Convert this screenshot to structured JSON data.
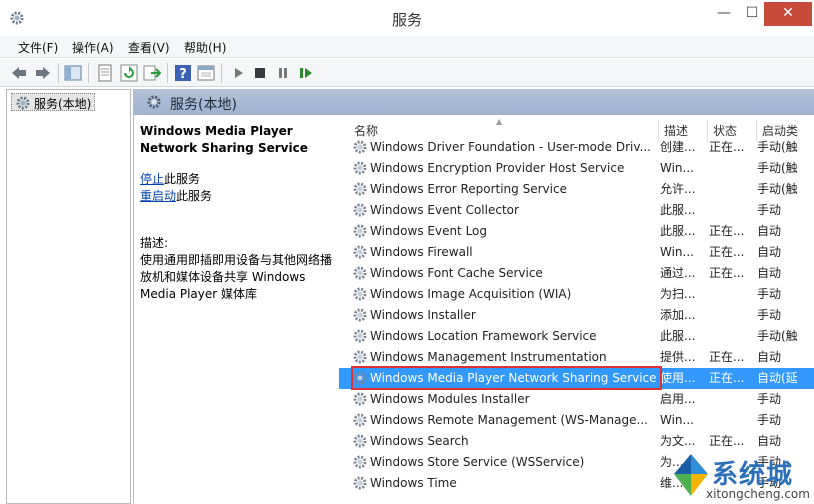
{
  "window": {
    "title": "服务",
    "minimize": "—",
    "maximize": "☐",
    "close": "✕"
  },
  "menu": [
    "文件(F)",
    "操作(A)",
    "查看(V)",
    "帮助(H)"
  ],
  "tree": {
    "root": "服务(本地)"
  },
  "main": {
    "header": "服务(本地)",
    "details": {
      "service_name": "Windows Media Player Network Sharing Service",
      "stop_link": "停止",
      "stop_suffix": "此服务",
      "restart_link": "重启动",
      "restart_suffix": "此服务",
      "desc_label": "描述:",
      "desc_text": "使用通用即插即用设备与其他网络播放机和媒体设备共享 Windows Media Player 媒体库"
    }
  },
  "columns": {
    "name": "名称",
    "desc": "描述",
    "status": "状态",
    "startup": "启动类"
  },
  "rows": [
    {
      "name": "Windows Driver Foundation - User-mode Driv...",
      "desc": "创建...",
      "status": "正在...",
      "startup": "手动(触"
    },
    {
      "name": "Windows Encryption Provider Host Service",
      "desc": "Win...",
      "status": "",
      "startup": "手动(触"
    },
    {
      "name": "Windows Error Reporting Service",
      "desc": "允许...",
      "status": "",
      "startup": "手动(触"
    },
    {
      "name": "Windows Event Collector",
      "desc": "此服...",
      "status": "",
      "startup": "手动"
    },
    {
      "name": "Windows Event Log",
      "desc": "此服...",
      "status": "正在...",
      "startup": "自动"
    },
    {
      "name": "Windows Firewall",
      "desc": "Win...",
      "status": "正在...",
      "startup": "自动"
    },
    {
      "name": "Windows Font Cache Service",
      "desc": "通过...",
      "status": "正在...",
      "startup": "自动"
    },
    {
      "name": "Windows Image Acquisition (WIA)",
      "desc": "为扫...",
      "status": "",
      "startup": "手动"
    },
    {
      "name": "Windows Installer",
      "desc": "添加...",
      "status": "",
      "startup": "手动"
    },
    {
      "name": "Windows Location Framework Service",
      "desc": "此服...",
      "status": "",
      "startup": "手动(触"
    },
    {
      "name": "Windows Management Instrumentation",
      "desc": "提供...",
      "status": "正在...",
      "startup": "自动"
    },
    {
      "name": "Windows Media Player Network Sharing Service",
      "desc": "使用...",
      "status": "正在...",
      "startup": "自动(延"
    },
    {
      "name": "Windows Modules Installer",
      "desc": "启用...",
      "status": "",
      "startup": "手动"
    },
    {
      "name": "Windows Remote Management (WS-Manage...",
      "desc": "Win...",
      "status": "",
      "startup": "手动"
    },
    {
      "name": "Windows Search",
      "desc": "为文...",
      "status": "正在...",
      "startup": "自动"
    },
    {
      "name": "Windows Store Service (WSService)",
      "desc": "为...",
      "status": "",
      "startup": "手动"
    },
    {
      "name": "Windows Time",
      "desc": "维...",
      "status": "",
      "startup": "手动"
    }
  ],
  "selected_row": 11,
  "watermark": {
    "text": "系统城",
    "url": "xitongcheng.com"
  },
  "colors": {
    "selection": "#3399ff",
    "header_bg": "#a9bcd6",
    "link": "#0645ad",
    "highlight_box": "#e03030"
  }
}
